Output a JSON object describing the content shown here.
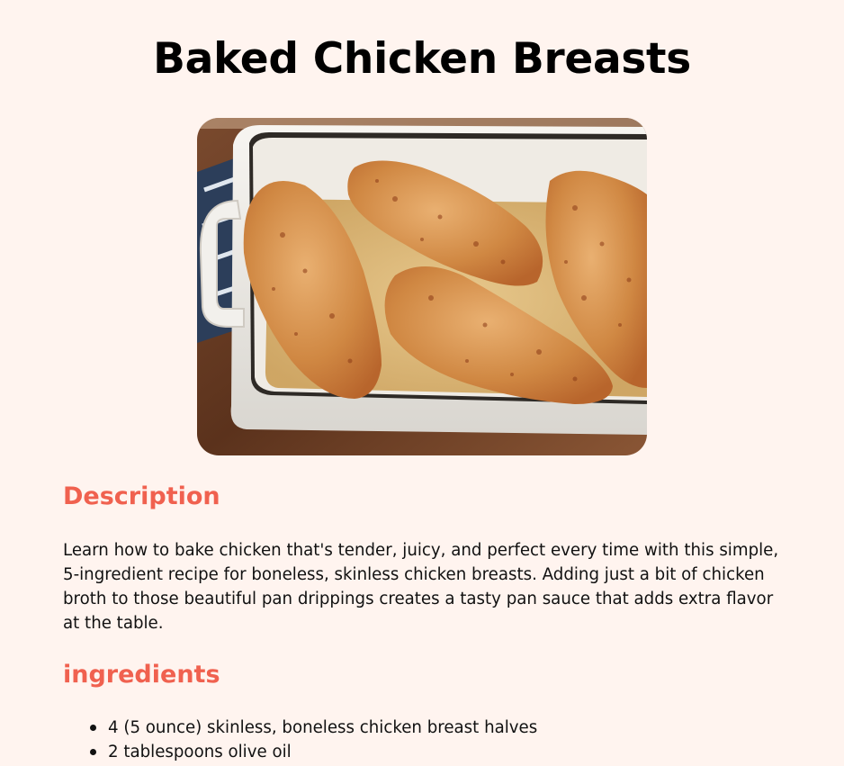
{
  "recipe": {
    "title": "Baked Chicken Breasts",
    "image": {
      "icon": "baked-chicken-photo"
    },
    "description_heading": "Description",
    "description_text": "Learn how to bake chicken that's tender, juicy, and perfect every time with this simple, 5-ingredient recipe for boneless, skinless chicken breasts. Adding just a bit of chicken broth to those beautiful pan drippings creates a tasty pan sauce that adds extra flavor at the table.",
    "ingredients_heading": "ingredients",
    "ingredients": [
      "4 (5 ounce) skinless, boneless chicken breast halves",
      "2 tablespoons olive oil"
    ]
  },
  "colors": {
    "background": "#fff4ef",
    "heading_accent": "#f0614f",
    "text": "#111111"
  }
}
